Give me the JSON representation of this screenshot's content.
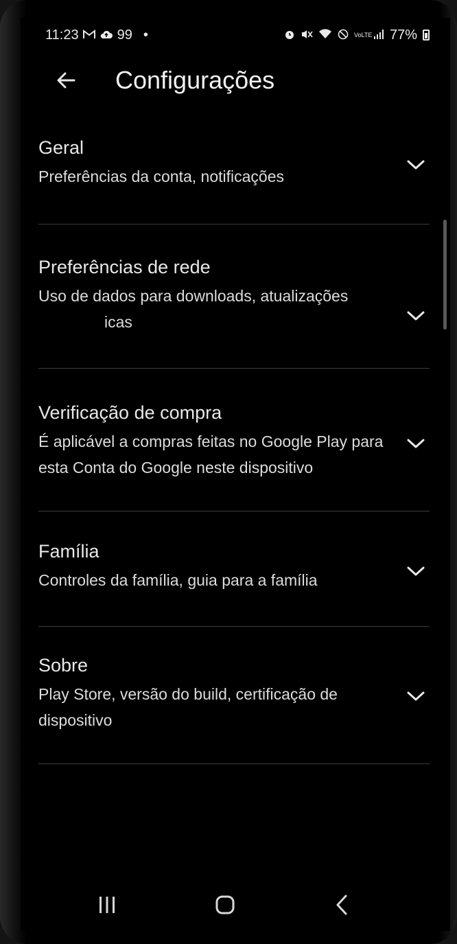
{
  "status_bar": {
    "time": "11:23",
    "left_icons": [
      "gmail-icon",
      "cloud-upload-icon"
    ],
    "notification_count": "99",
    "dot": "•",
    "right_icons": [
      "alarm-icon",
      "mute-icon",
      "wifi-icon",
      "do-not-disturb-icon",
      "volte-icon",
      "signal-icon"
    ],
    "volte_label": "VoLTE",
    "battery": "77%"
  },
  "app_bar": {
    "back_icon": "arrow-left-icon",
    "title": "Configurações"
  },
  "sections": [
    {
      "title": "Geral",
      "description": "Preferências da conta, notificações"
    },
    {
      "title": "Preferências de rede",
      "description": "Uso de dados para downloads, atualizações",
      "description_partial": "icas"
    },
    {
      "title": "Verificação de compra",
      "description": "É aplicável a compras feitas no Google Play para esta Conta do Google neste dispositivo"
    },
    {
      "title": "Família",
      "description": "Controles da família, guia para a família"
    },
    {
      "title": "Sobre",
      "description": "Play Store, versão do build, certificação de dispositivo"
    }
  ],
  "chevron_icon": "chevron-down-icon",
  "nav_bar": {
    "recents_icon": "recents-icon",
    "home_icon": "home-icon",
    "back_icon": "back-icon"
  },
  "colors": {
    "background": "#000000",
    "text_primary": "#e8e8e8",
    "divider": "#3d3d3d"
  }
}
